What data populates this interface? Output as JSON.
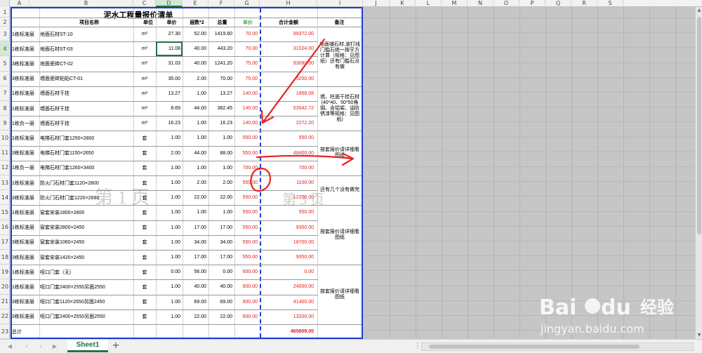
{
  "sheet_tab": "Sheet1",
  "add_sheet_icon": "plus-icon",
  "selected_column": "D",
  "selected_row": "4",
  "columns": [
    "A",
    "B",
    "C",
    "D",
    "E",
    "F",
    "G",
    "H",
    "I",
    "J",
    "K",
    "L",
    "M",
    "N",
    "O",
    "P",
    "Q",
    "R",
    "S"
  ],
  "title": "泥水工程量报价清单",
  "headers": {
    "name": "项目名称",
    "unit": "单位",
    "price": "单价",
    "floors": "层数*2",
    "qty": "总量",
    "unitprice": "单价",
    "total": "合计金额",
    "remark": "备注"
  },
  "rows": [
    {
      "n": "3",
      "a": "1栋标准层",
      "b": "地面石材ST-10",
      "c": "m²",
      "d": "27.30",
      "e": "52.00",
      "f": "1419.60",
      "g": "70.00",
      "h": "99372.00"
    },
    {
      "n": "4",
      "a": "1栋标准层",
      "b": "地面石材ST-03",
      "c": "m²",
      "d": "11.08",
      "e": "40.00",
      "f": "443.20",
      "g": "70.00",
      "h": "31024.00"
    },
    {
      "n": "5",
      "a": "3栋标准层",
      "b": "地面瓷砖CT-02",
      "c": "m²",
      "d": "31.03",
      "e": "40.00",
      "f": "1241.20",
      "g": "75.00",
      "h": "93090.00"
    },
    {
      "n": "6",
      "a": "3栋标准层",
      "b": "墙面瓷砖贴贴CT-01",
      "c": "m²",
      "d": "35.00",
      "e": "2.00",
      "f": "70.00",
      "g": "75.00",
      "h": "5250.00"
    },
    {
      "n": "7",
      "a": "1栋标准层",
      "b": "墙面石材干挂",
      "c": "m²",
      "d": "13.27",
      "e": "1.00",
      "f": "13.27",
      "g": "140.00",
      "h": "1858.08"
    },
    {
      "n": "8",
      "a": "1栋标准层",
      "b": "墙面石材干挂",
      "c": "m²",
      "d": "8.69",
      "e": "44.00",
      "f": "382.45",
      "g": "140.00",
      "h": "53542.72"
    },
    {
      "n": "9",
      "a": "1栋负一层",
      "b": "墙面石材干挂",
      "c": "m²",
      "d": "16.23",
      "e": "1.00",
      "f": "16.23",
      "g": "140.00",
      "h": "2272.20"
    },
    {
      "n": "10",
      "a": "1栋标准层",
      "b": "电梯石材门套1250×2800",
      "c": "套",
      "d": "1.00",
      "e": "1.00",
      "f": "1.00",
      "g": "550.00",
      "h": "550.00"
    },
    {
      "n": "11",
      "a": "3栋标准层",
      "b": "电梯石材门套1150×2650",
      "c": "套",
      "d": "2.00",
      "e": "44.00",
      "f": "88.00",
      "g": "550.00",
      "h": "48400.00"
    },
    {
      "n": "12",
      "a": "1栋负一层",
      "b": "电梯石材门套1260×3400",
      "c": "套",
      "d": "1.00",
      "e": "1.00",
      "f": "1.00",
      "g": "700.00",
      "h": "700.00"
    },
    {
      "n": "13",
      "a": "1栋标准层",
      "b": "防火门石材门套1120×2800",
      "c": "套",
      "d": "1.00",
      "e": "2.00",
      "f": "2.00",
      "g": "550.00",
      "h": "1100.00"
    },
    {
      "n": "14",
      "a": "3栋标准层",
      "b": "防火门石材门套1220×2680",
      "c": "套",
      "d": "1.00",
      "e": "22.00",
      "f": "22.00",
      "g": "550.00",
      "h": "12100.00"
    },
    {
      "n": "15",
      "a": "1栋标准层",
      "b": "窗套安装1800×2800",
      "c": "套",
      "d": "1.00",
      "e": "1.00",
      "f": "1.00",
      "g": "550.00",
      "h": "550.00"
    },
    {
      "n": "16",
      "a": "1栋标准层",
      "b": "窗套安装2800×2450",
      "c": "套",
      "d": "1.00",
      "e": "17.00",
      "f": "17.00",
      "g": "550.00",
      "h": "9350.00"
    },
    {
      "n": "17",
      "a": "3栋标准层",
      "b": "窗套安装1060×2450",
      "c": "套",
      "d": "1.00",
      "e": "34.00",
      "f": "34.00",
      "g": "550.00",
      "h": "18700.00"
    },
    {
      "n": "18",
      "a": "3栋标准层",
      "b": "窗套安装1420×2450",
      "c": "套",
      "d": "1.00",
      "e": "17.00",
      "f": "17.00",
      "g": "550.00",
      "h": "9350.00"
    },
    {
      "n": "19",
      "a": "1栋标准层",
      "b": "哑口门套（无）",
      "c": "套",
      "d": "0.00",
      "e": "56.00",
      "f": "0.00",
      "g": "600.00",
      "h": "0.00"
    },
    {
      "n": "20",
      "a": "1栋标准层",
      "b": "哑口门套2400×2550另面2550",
      "c": "套",
      "d": "1.00",
      "e": "40.00",
      "f": "40.00",
      "g": "600.00",
      "h": "24000.00"
    },
    {
      "n": "21",
      "a": "3栋标准层",
      "b": "哑口门套1120×2650另面2450",
      "c": "套",
      "d": "1.00",
      "e": "69.00",
      "f": "69.00",
      "g": "600.00",
      "h": "41400.00"
    },
    {
      "n": "22",
      "a": "3栋标准层",
      "b": "哑口门套2400×2550另面2550",
      "c": "套",
      "d": "1.00",
      "e": "22.00",
      "f": "22.00",
      "g": "600.00",
      "h": "13200.00"
    }
  ],
  "total_row": {
    "n": "23",
    "label": "总计",
    "value": "465809.00"
  },
  "notes": {
    "n1": "地面铺石材,波打线门槛石统一按平方计算（规格：见图纸）还有门槛石没有做",
    "n2": "墙、柱面干挂石材(40*40、50*50角钢、含铝架、油防锈漆等规格：见图纸)",
    "n3": "按套报价请详细看图纸",
    "n4": "还有几个没有做完",
    "n5": "按套报价请详细看图纸",
    "n6": "按套报价请详细看图纸"
  },
  "watermarks": {
    "page1": "第 1 页",
    "page3": "第 3 页"
  },
  "baidu": {
    "logo": "Bai",
    "du": "du",
    "jingyan": "经验",
    "url": "jingyan.baidu.com"
  },
  "colors": {
    "accent": "#217346",
    "page_border": "#1f3bd6",
    "red_value": "#e11d1d",
    "annotation_red": "#e8231f"
  }
}
